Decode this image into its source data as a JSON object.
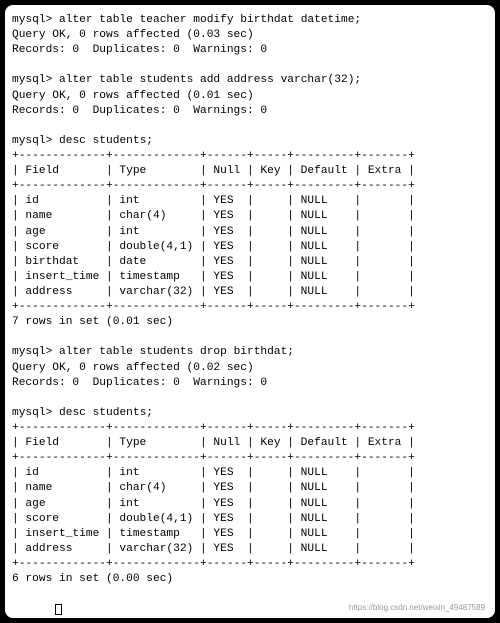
{
  "prompt": "mysql>",
  "cmd1": "alter table teacher modify birthdat datetime;",
  "res1_line1": "Query OK, 0 rows affected (0.03 sec)",
  "res1_line2": "Records: 0  Duplicates: 0  Warnings: 0",
  "cmd2": "alter table students add address varchar(32);",
  "res2_line1": "Query OK, 0 rows affected (0.01 sec)",
  "res2_line2": "Records: 0  Duplicates: 0  Warnings: 0",
  "cmd3": "desc students;",
  "t1_border": "+-------------+-------------+------+-----+---------+-------+",
  "t1_header": "| Field       | Type        | Null | Key | Default | Extra |",
  "t1_r1": "| id          | int         | YES  |     | NULL    |       |",
  "t1_r2": "| name        | char(4)     | YES  |     | NULL    |       |",
  "t1_r3": "| age         | int         | YES  |     | NULL    |       |",
  "t1_r4": "| score       | double(4,1) | YES  |     | NULL    |       |",
  "t1_r5": "| birthdat    | date        | YES  |     | NULL    |       |",
  "t1_r6": "| insert_time | timestamp   | YES  |     | NULL    |       |",
  "t1_r7": "| address     | varchar(32) | YES  |     | NULL    |       |",
  "t1_summary": "7 rows in set (0.01 sec)",
  "cmd4": "alter table students drop birthdat;",
  "res4_line1": "Query OK, 0 rows affected (0.02 sec)",
  "res4_line2": "Records: 0  Duplicates: 0  Warnings: 0",
  "cmd5": "desc students;",
  "t2_r1": "| id          | int         | YES  |     | NULL    |       |",
  "t2_r2": "| name        | char(4)     | YES  |     | NULL    |       |",
  "t2_r3": "| age         | int         | YES  |     | NULL    |       |",
  "t2_r4": "| score       | double(4,1) | YES  |     | NULL    |       |",
  "t2_r5": "| insert_time | timestamp   | YES  |     | NULL    |       |",
  "t2_r6": "| address     | varchar(32) | YES  |     | NULL    |       |",
  "t2_summary": "6 rows in set (0.00 sec)",
  "watermark": "https://blog.csdn.net/weixin_49487589"
}
